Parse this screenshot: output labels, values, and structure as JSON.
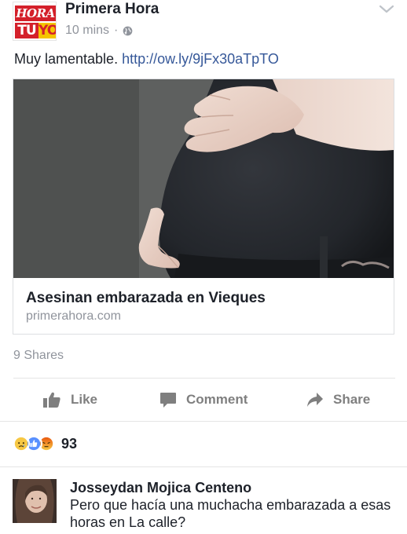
{
  "post": {
    "page_name": "Primera Hora",
    "logo": {
      "top_small": "Primera",
      "top": "HORA",
      "bottom_a": "TU",
      "bottom_b": "YO"
    },
    "time": "10 mins",
    "dot": "·",
    "privacy_icon": "globe-icon",
    "menu_icon": "chevron-down-icon",
    "text_prefix": "Muy lamentable. ",
    "link_text": "http://ow.ly/9jFx30aTpTO"
  },
  "link_card": {
    "title": "Asesinan embarazada en Vieques",
    "domain": "primerahora.com"
  },
  "stats": {
    "shares": "9 Shares"
  },
  "actions": [
    {
      "label": "Like",
      "icon": "thumbs-up-icon"
    },
    {
      "label": "Comment",
      "icon": "comment-icon"
    },
    {
      "label": "Share",
      "icon": "share-arrow-icon"
    }
  ],
  "reactions": {
    "icons": [
      "sad-icon",
      "like-icon",
      "angry-icon"
    ],
    "count": "93"
  },
  "comment": {
    "name": "Josseydan Mojica Centeno",
    "text": "Pero que hacía una muchacha embarazada a esas horas en La calle?"
  },
  "colors": {
    "link": "#365899",
    "meta": "#90949c",
    "like_blue": "#5890ff",
    "sad_yellow": "#f7c844",
    "angry_red": "#e9710f",
    "logo_red": "#d4202a",
    "logo_yellow": "#f5c400"
  }
}
